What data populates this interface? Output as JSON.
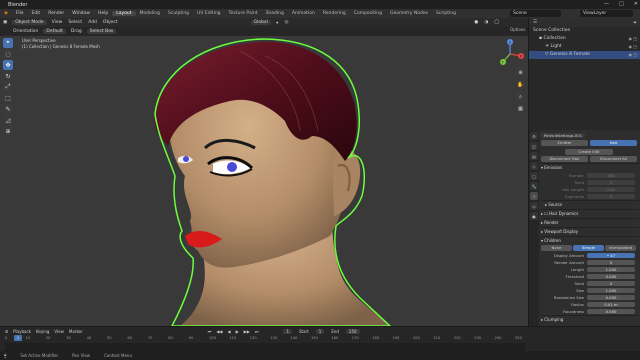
{
  "app": {
    "title": "Blender"
  },
  "menu": [
    "File",
    "Edit",
    "Render",
    "Window",
    "Help"
  ],
  "workspaces": [
    "Layout",
    "Modeling",
    "Sculpting",
    "UV Editing",
    "Texture Paint",
    "Shading",
    "Animation",
    "Rendering",
    "Compositing",
    "Geometry Nodes",
    "Scripting"
  ],
  "active_workspace": "Layout",
  "scene": {
    "label": "Scene"
  },
  "view_layer": {
    "label": "ViewLayer"
  },
  "viewport_header": {
    "mode": "Object Mode",
    "menus": [
      "View",
      "Select",
      "Add",
      "Object"
    ],
    "orientation_label": "Orientation",
    "orientation": "Default",
    "drag_label": "Drag",
    "drag": "Select Box",
    "transform": "Global",
    "options": "Options"
  },
  "viewport": {
    "info_line1": "User Perspective",
    "info_line2": "(1) Collection | Genesis 8 Female Mesh"
  },
  "gizmo": {
    "x": "X",
    "y": "Y",
    "z": "Z"
  },
  "tools": [
    "⌖",
    "◌",
    "✥",
    "↻",
    "⤢",
    "⬚",
    "✎",
    "◿",
    "⊕"
  ],
  "nav_icons": [
    "⊕",
    "✋",
    "⌕",
    "▦"
  ],
  "outliner": {
    "rows": [
      {
        "label": "Scene Collection",
        "indent": 0
      },
      {
        "label": "Collection",
        "indent": 1
      },
      {
        "label": "Light",
        "indent": 2
      },
      {
        "label": "Genesis 8 Female",
        "indent": 2,
        "selected": true
      }
    ]
  },
  "properties": {
    "system_name": "ParticleSettings.001",
    "emitter_label": "Emitter",
    "hair_label": "Hair",
    "regrow_label": "Regrow Hair",
    "advanced_label": "Advanced",
    "create_edit": "Create Edit",
    "disconnect": "Disconnect Hair",
    "disconnect_all": "Disconnect All",
    "emission_title": "Emission",
    "emission": [
      {
        "label": "Number",
        "value": "500"
      },
      {
        "label": "Seed",
        "value": "0"
      },
      {
        "label": "Hair Length",
        "value": "0 m"
      },
      {
        "label": "Segments",
        "value": "5"
      }
    ],
    "source": "Source",
    "hair_dynamics": "Hair Dynamics",
    "render": "Render",
    "viewport_display": "Viewport Display",
    "children": "Children",
    "children_modes": [
      "None",
      "Simple",
      "Interpolated"
    ],
    "children_active": "Simple",
    "children_fields": [
      {
        "label": "Display Amount",
        "value": "• 47"
      },
      {
        "label": "Render Amount",
        "value": "0"
      },
      {
        "label": "Length",
        "value": "1.000"
      },
      {
        "label": "Threshold",
        "value": "0.000"
      },
      {
        "label": "Seed",
        "value": "0"
      },
      {
        "label": "Size",
        "value": "1.000"
      },
      {
        "label": "Randomize Size",
        "value": "0.000"
      },
      {
        "label": "Radius",
        "value": "0.01 m"
      },
      {
        "label": "Roundness",
        "value": "0.000"
      }
    ],
    "clumping": "Clumping"
  },
  "timeline": {
    "menus": [
      "Playback",
      "Keying",
      "View",
      "Marker"
    ],
    "current_frame": "1",
    "start_label": "Start",
    "start": "1",
    "end_label": "End",
    "end": "250",
    "ticks": [
      "0",
      "10",
      "20",
      "30",
      "40",
      "50",
      "60",
      "70",
      "80",
      "90",
      "100",
      "110",
      "120",
      "130",
      "140",
      "150",
      "160",
      "170",
      "180",
      "190",
      "200",
      "210",
      "220",
      "230",
      "240",
      "250"
    ]
  },
  "statusbar": [
    "Set Active Modifier",
    "Pan View",
    "Context Menu"
  ],
  "colors": {
    "accent": "#4772b3",
    "outline": "#6bff3c",
    "lips": "#d81a1a",
    "hair": "#5c1020",
    "skin": "#c49d76"
  }
}
